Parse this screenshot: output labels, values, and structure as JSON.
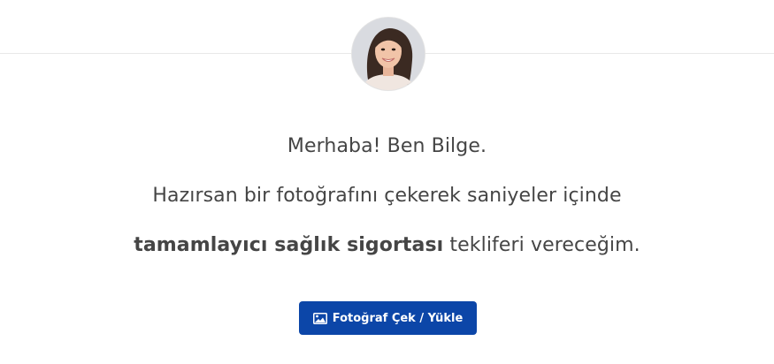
{
  "greeting": {
    "line1": "Merhaba! Ben Bilge.",
    "line2": "Hazırsan bir fotoğrafını çekerek saniyeler içinde",
    "line3_bold": "tamamlayıcı sağlık sigortası",
    "line3_rest": " tekliferi vereceğim."
  },
  "button": {
    "label": "Fotoğraf Çek / Yükle",
    "icon": "image-icon"
  },
  "colors": {
    "accent": "#0c46a8",
    "text": "#454545"
  }
}
